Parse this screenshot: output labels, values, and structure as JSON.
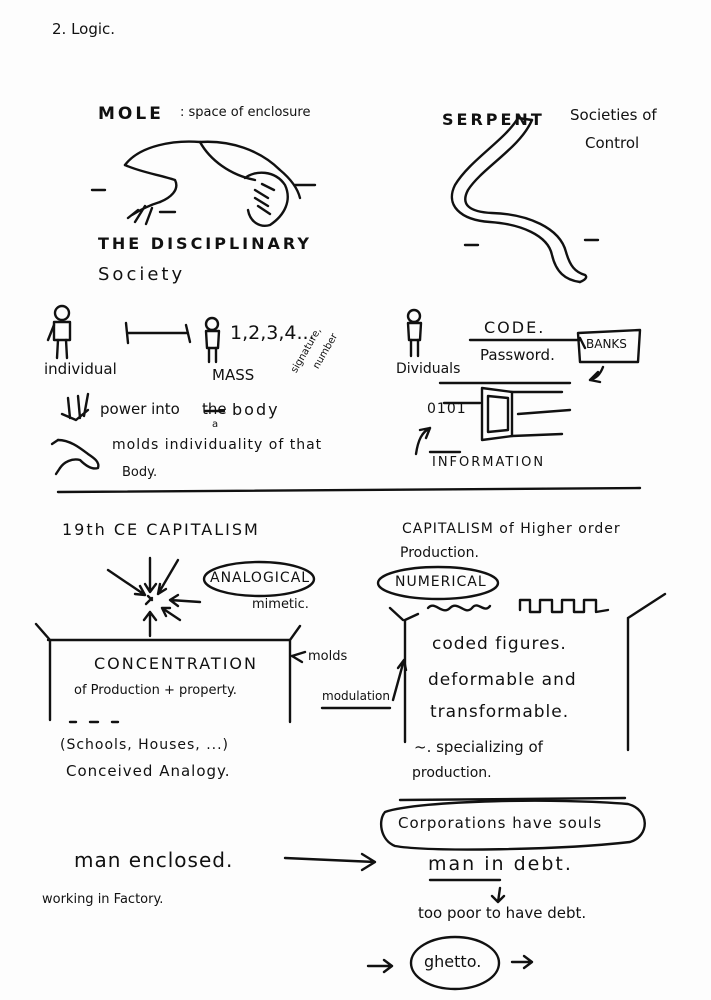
{
  "header": {
    "title": "2. Logic."
  },
  "left_top": {
    "mole_label": "MOLE",
    "mole_desc": ": space of enclosure",
    "society_line1": "THE DISCIPLINARY",
    "society_line2": "Society",
    "individual": "individual",
    "count": "1,2,3,4...",
    "mass": "MASS",
    "signature_line1": "signature,",
    "signature_line2": "number",
    "power_pre": "power into",
    "power_struck": "the",
    "power_post": "body",
    "power_insert": "a",
    "molds_line1": "molds individuality of that",
    "molds_line2": "Body."
  },
  "right_top": {
    "serpent_label": "SERPENT",
    "control_line1": "Societies of",
    "control_line2": "Control",
    "dividuals": "Dividuals",
    "code": "CODE.",
    "password": "Password.",
    "banks": "BANKS",
    "binary": "0101",
    "information": "INFORMATION"
  },
  "left_bottom": {
    "capitalism_19": "19th CE CAPITALISM",
    "analogical": "ANALOGICAL",
    "mimetic": "mimetic.",
    "concentration_line1": "CONCENTRATION",
    "concentration_line2": "of Production + property.",
    "molds": "molds",
    "schools": "(Schools, Houses, ...)",
    "conceived": "Conceived Analogy.",
    "man_enclosed": "man enclosed.",
    "working": "working in Factory."
  },
  "right_bottom": {
    "capitalism_higher_line1": "CAPITALISM of Higher order",
    "capitalism_higher_line2": "Production.",
    "numerical": "NUMERICAL",
    "modulation": "modulation",
    "coded": "coded figures.",
    "deformable": "deformable and",
    "transformable": "transformable.",
    "specializing_line1": "~. specializing of",
    "specializing_line2": "production.",
    "corporations": "Corporations have souls",
    "man_debt": "man in debt.",
    "too_poor": "too poor to have debt.",
    "ghetto": "ghetto."
  }
}
